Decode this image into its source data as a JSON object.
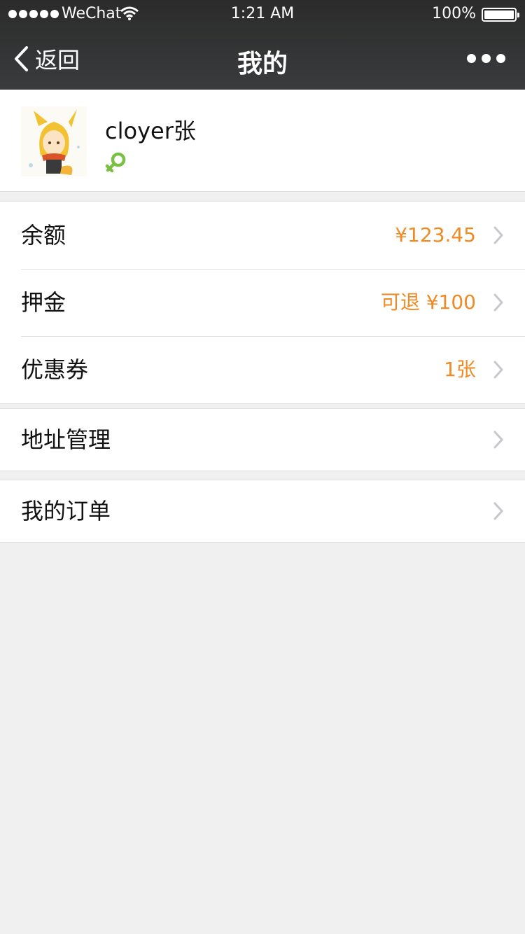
{
  "status_bar": {
    "carrier": "WeChat",
    "time": "1:21 AM",
    "battery": "100%"
  },
  "nav": {
    "back_label": "返回",
    "title": "我的"
  },
  "profile": {
    "username": "cloyer张",
    "gender_icon": "female-symbol-icon",
    "gender_color": "#7ac143"
  },
  "groups": [
    {
      "rows": [
        {
          "label": "余额",
          "value": "¥123.45"
        },
        {
          "label": "押金",
          "value": "可退 ¥100"
        },
        {
          "label": "优惠券",
          "value": "1张"
        }
      ]
    },
    {
      "rows": [
        {
          "label": "地址管理",
          "value": ""
        }
      ]
    },
    {
      "rows": [
        {
          "label": "我的订单",
          "value": ""
        }
      ]
    }
  ],
  "colors": {
    "accent_value": "#f08a24",
    "nav_background": "#2f3032",
    "page_background": "#f0f0f0"
  }
}
